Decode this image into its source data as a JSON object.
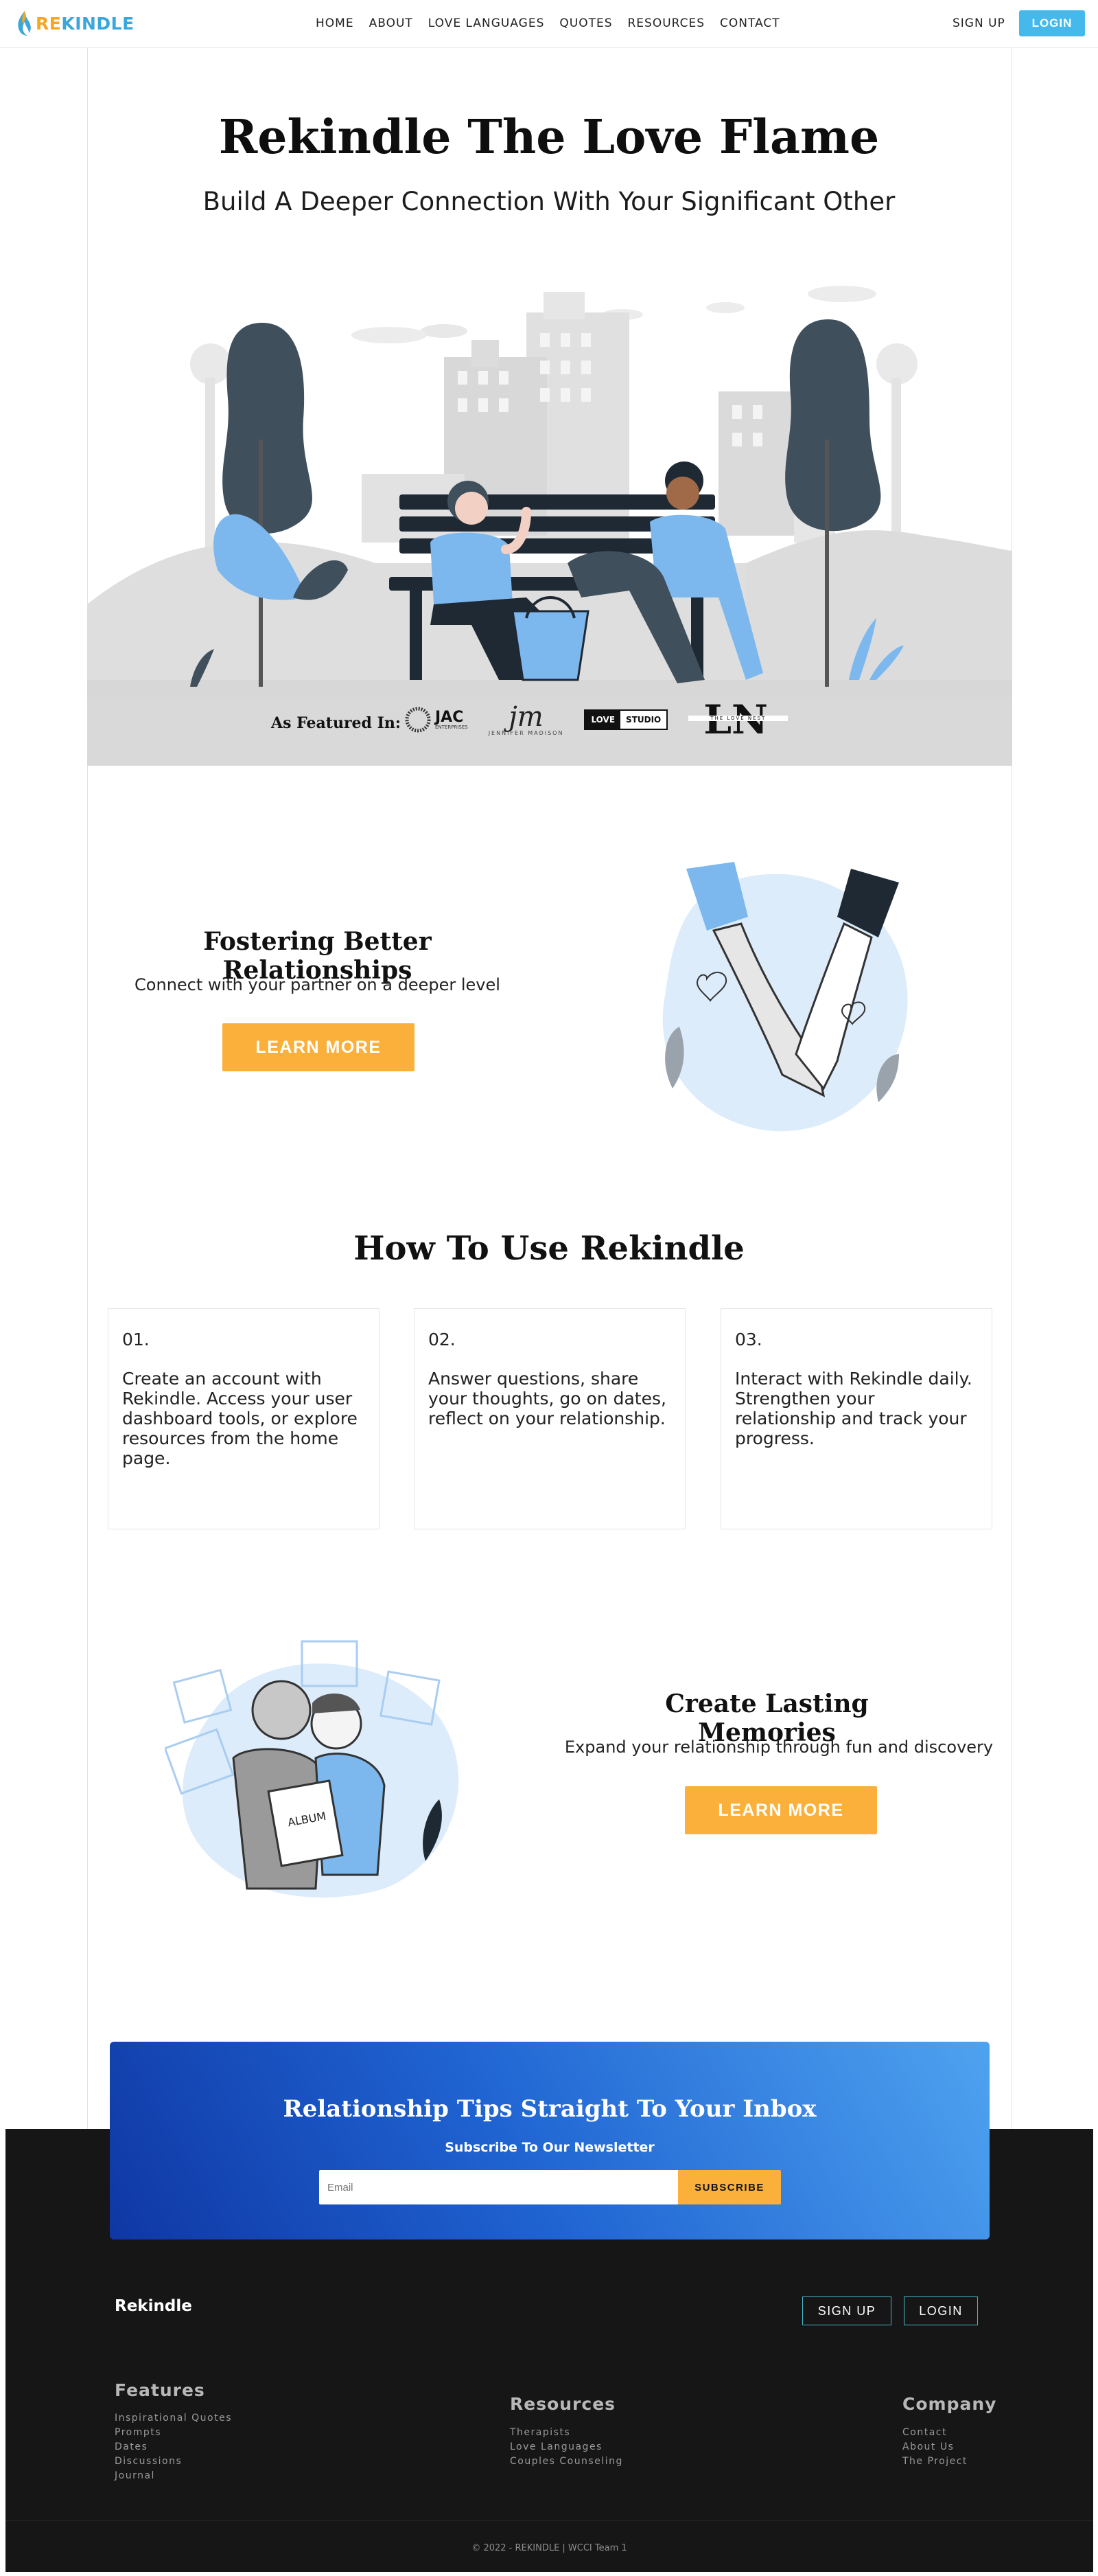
{
  "nav": {
    "logo": {
      "part1": "RE",
      "part2": "KINDLE"
    },
    "items": [
      "HOME",
      "ABOUT",
      "LOVE LANGUAGES",
      "QUOTES",
      "RESOURCES",
      "CONTACT"
    ],
    "signup": "SIGN UP",
    "login": "LOGIN"
  },
  "hero": {
    "title": "Rekindle The Love Flame",
    "subtitle": "Build A Deeper Connection With Your Significant Other",
    "featured_label": "As Featured In:",
    "featured_logos": [
      "JAC",
      "ENTERPRISES",
      "jm",
      "JENNIFER MADISON",
      "LOVE",
      "STUDIO",
      "LN",
      "THE LOVE NEST"
    ]
  },
  "fostering": {
    "title": "Fostering Better Relationships",
    "subtitle": "Connect with your partner on a deeper level",
    "button": "LEARN MORE"
  },
  "how": {
    "title": "How To Use Rekindle",
    "cards": [
      {
        "num": "01.",
        "text": "Create an account with Rekindle. Access your user dashboard tools, or explore resources from the home page."
      },
      {
        "num": "02.",
        "text": "Answer questions, share your thoughts, go on dates, reflect on your relationship."
      },
      {
        "num": "03.",
        "text": "Interact with Rekindle daily. Strengthen your relationship and track your progress."
      }
    ]
  },
  "memories": {
    "title": "Create Lasting Memories",
    "subtitle": "Expand your relationship through fun and discovery",
    "button": "LEARN MORE",
    "album_text": "ALBUM"
  },
  "newsletter": {
    "title": "Relationship Tips Straight To Your Inbox",
    "subtitle": "Subscribe To Our Newsletter",
    "placeholder": "Email",
    "button": "SUBSCRIBE"
  },
  "footer": {
    "brand": "Rekindle",
    "signup": "SIGN UP",
    "login": "LOGIN",
    "features": {
      "title": "Features",
      "links": [
        "Inspirational Quotes",
        "Prompts",
        "Dates",
        "Discussions",
        "Journal"
      ]
    },
    "resources": {
      "title": "Resources",
      "links": [
        "Therapists",
        "Love Languages",
        "Couples Counseling"
      ]
    },
    "company": {
      "title": "Company",
      "links": [
        "Contact",
        "About Us",
        "The Project"
      ]
    },
    "copyright": "© 2022 - REKINDLE | WCCI Team 1"
  },
  "colors": {
    "accent_blue": "#45b8ec",
    "accent_orange": "#fbb03b",
    "footer_bg": "#161616",
    "illustration_blue": "#7cb8ee",
    "illustration_dark": "#3f4f5c"
  }
}
